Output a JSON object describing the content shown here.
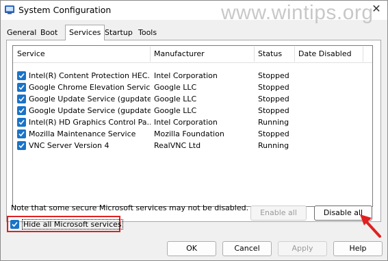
{
  "window": {
    "title": "System Configuration",
    "close_glyph": "✕",
    "watermark": "www.wintips.org"
  },
  "tabs": [
    {
      "label": "General"
    },
    {
      "label": "Boot"
    },
    {
      "label": "Services"
    },
    {
      "label": "Startup"
    },
    {
      "label": "Tools"
    }
  ],
  "active_tab": "Services",
  "services": {
    "columns": [
      "Service",
      "Manufacturer",
      "Status",
      "Date Disabled"
    ],
    "rows": [
      {
        "checked": true,
        "service": "Intel(R) Content Protection HEC...",
        "manufacturer": "Intel Corporation",
        "status": "Stopped",
        "date_disabled": ""
      },
      {
        "checked": true,
        "service": "Google Chrome Elevation Servic...",
        "manufacturer": "Google LLC",
        "status": "Stopped",
        "date_disabled": ""
      },
      {
        "checked": true,
        "service": "Google Update Service (gupdate)",
        "manufacturer": "Google LLC",
        "status": "Stopped",
        "date_disabled": ""
      },
      {
        "checked": true,
        "service": "Google Update Service (gupdatem)",
        "manufacturer": "Google LLC",
        "status": "Stopped",
        "date_disabled": ""
      },
      {
        "checked": true,
        "service": "Intel(R) HD Graphics Control Pa...",
        "manufacturer": "Intel Corporation",
        "status": "Running",
        "date_disabled": ""
      },
      {
        "checked": true,
        "service": "Mozilla Maintenance Service",
        "manufacturer": "Mozilla Foundation",
        "status": "Stopped",
        "date_disabled": ""
      },
      {
        "checked": true,
        "service": "VNC Server Version 4",
        "manufacturer": "RealVNC Ltd",
        "status": "Running",
        "date_disabled": ""
      }
    ]
  },
  "note": "Note that some secure Microsoft services may not be disabled.",
  "buttons": {
    "enable_all": "Enable all",
    "disable_all": "Disable all",
    "ok": "OK",
    "cancel": "Cancel",
    "apply": "Apply",
    "help": "Help"
  },
  "hide_ms": {
    "label": "Hide all Microsoft services",
    "checked": true
  },
  "colors": {
    "checkbox": "#1a73c8",
    "highlight_box": "#e02020",
    "arrow": "#e02020"
  },
  "icons": {
    "app": "system-config-icon",
    "close": "close-icon",
    "check": "checkmark-icon",
    "arrow": "red-arrow-icon"
  }
}
